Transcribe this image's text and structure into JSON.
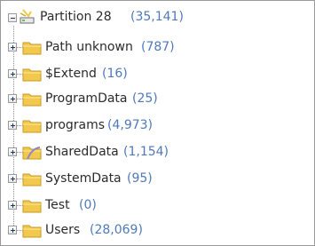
{
  "tree": {
    "root": {
      "name": "Partition 28",
      "count": "(35,141)",
      "icon": "partition-icon"
    },
    "children": [
      {
        "name": "Path unknown",
        "count": "(787)",
        "icon": "folder-icon"
      },
      {
        "name": "$Extend",
        "count": "(16)",
        "icon": "folder-icon"
      },
      {
        "name": "ProgramData",
        "count": "(25)",
        "icon": "folder-icon"
      },
      {
        "name": "programs",
        "count": "(4,973)",
        "icon": "folder-icon"
      },
      {
        "name": "SharedData",
        "count": "(1,154)",
        "icon": "shared-folder-icon"
      },
      {
        "name": "SystemData",
        "count": "(95)",
        "icon": "folder-icon"
      },
      {
        "name": "Test",
        "count": "(0)",
        "icon": "folder-icon"
      },
      {
        "name": "Users",
        "count": "(28,069)",
        "icon": "folder-icon"
      }
    ]
  },
  "colors": {
    "label": "#2b2b2b",
    "count": "#4f79b8",
    "folder": "#f2c94c",
    "guide": "#8a8a8a"
  }
}
